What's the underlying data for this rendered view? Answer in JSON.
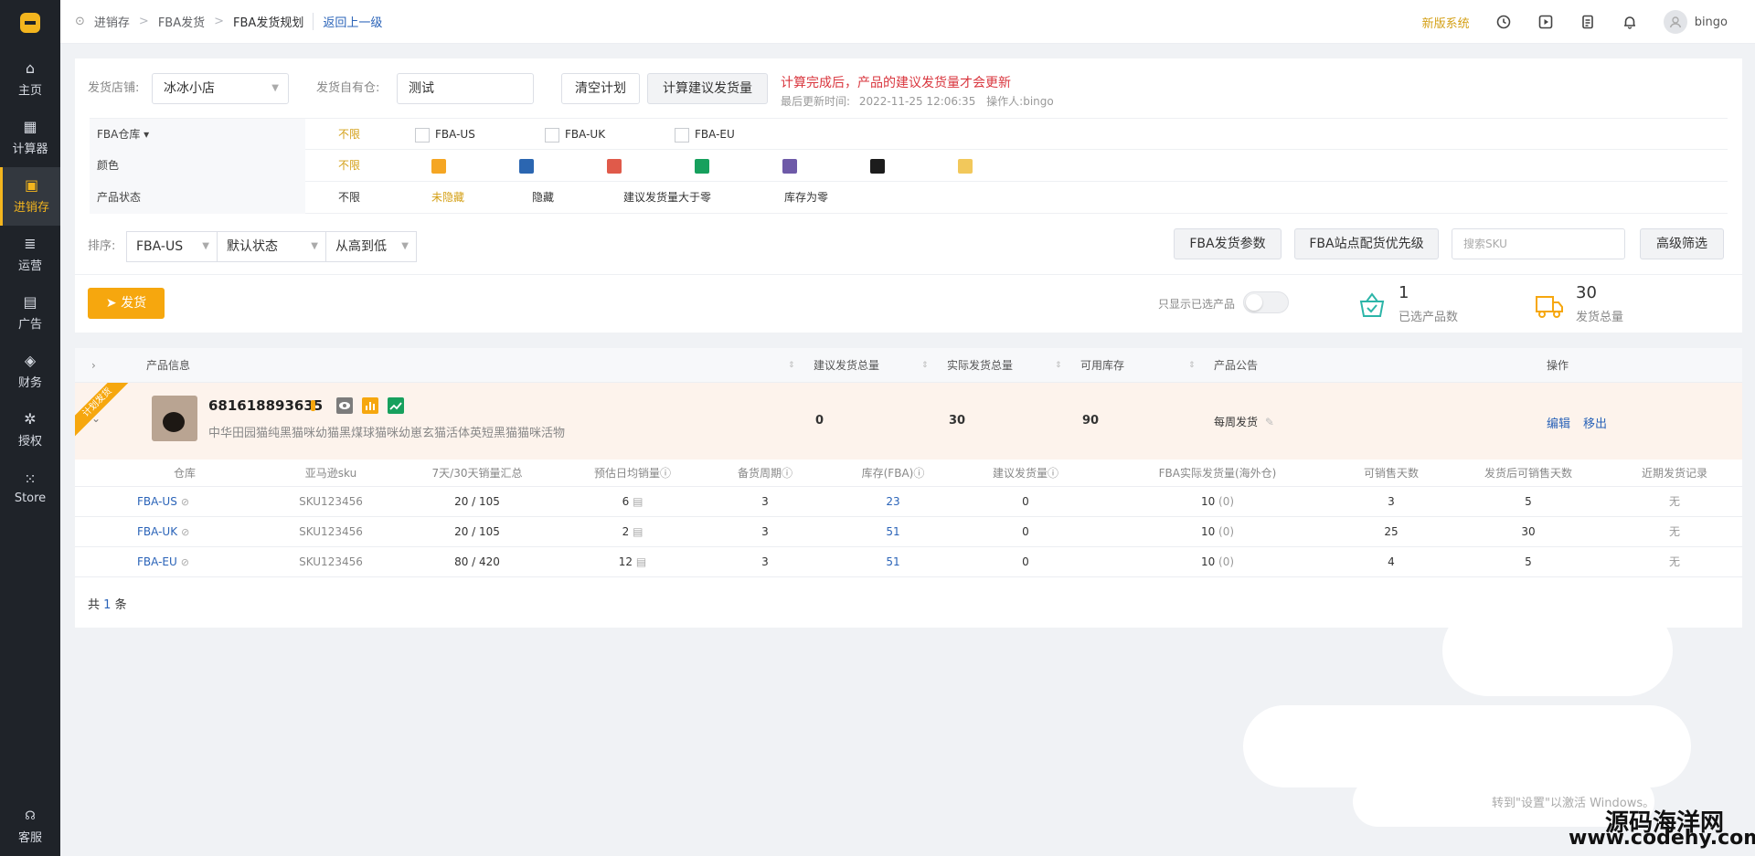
{
  "sidebar": {
    "items": [
      {
        "label": "主页",
        "icon": "home-icon"
      },
      {
        "label": "计算器",
        "icon": "calculator-icon"
      },
      {
        "label": "进销存",
        "icon": "inventory-icon"
      },
      {
        "label": "运营",
        "icon": "operation-icon"
      },
      {
        "label": "广告",
        "icon": "ad-icon"
      },
      {
        "label": "财务",
        "icon": "finance-icon"
      },
      {
        "label": "授权",
        "icon": "gear-icon"
      },
      {
        "label": "Store",
        "icon": "grid-icon"
      }
    ],
    "active": "进销存",
    "support_label": "客服"
  },
  "topbar": {
    "breadcrumb": [
      "进销存",
      "FBA发货",
      "FBA发货规划"
    ],
    "back_label": "返回上一级",
    "new_system_label": "新版系统",
    "username": "bingo"
  },
  "filters": {
    "store_label": "发货店铺:",
    "store_value": "冰冰小店",
    "warehouse_label": "发货自有仓:",
    "warehouse_value": "测试",
    "clear_btn": "清空计划",
    "calc_btn": "计算建议发货量",
    "warning": "计算完成后，产品的建议发货量才会更新",
    "last_update_label": "最后更新时间:",
    "last_update_time": "2022-11-25 12:06:35",
    "operator_label": "操作人:",
    "operator": "bingo",
    "fba_row": {
      "label": "FBA仓库 ▾",
      "options": [
        "不限",
        "FBA-US",
        "FBA-UK",
        "FBA-EU"
      ]
    },
    "color_row": {
      "label": "颜色",
      "all": "不限",
      "colors": [
        "#f5a623",
        "#2b66b1",
        "#e05a4a",
        "#16a05d",
        "#6e5aa8",
        "#1c1c1c",
        "#f2c85b"
      ]
    },
    "status_row": {
      "label": "产品状态",
      "options": [
        "不限",
        "未隐藏",
        "隐藏",
        "建议发货量大于零",
        "库存为零"
      ]
    }
  },
  "sort": {
    "label": "排序:",
    "warehouse": "FBA-US",
    "state": "默认状态",
    "order": "从高到低"
  },
  "actions": {
    "fba_params_btn": "FBA发货参数",
    "priority_btn": "FBA站点配货优先级",
    "search_placeholder": "搜索SKU",
    "advanced_btn": "高级筛选",
    "ship_btn": "发货",
    "only_selected_label": "只显示已选产品"
  },
  "stats": {
    "selected_count": "1",
    "selected_label": "已选产品数",
    "ship_total": "30",
    "ship_total_label": "发货总量"
  },
  "table": {
    "headers": [
      "产品信息",
      "建议发货总量",
      "实际发货总量",
      "可用库存",
      "产品公告",
      "操作"
    ],
    "product": {
      "ribbon": "计划发货",
      "id": "681618893635",
      "title": "中华田园猫纯黑猫咪幼猫黑煤球猫咪幼崽玄猫活体英短黑猫猫咪活物",
      "suggested_total": "0",
      "actual_total": "30",
      "available_stock": "90",
      "notice": "每周发货",
      "edit": "编辑",
      "remove": "移出"
    },
    "sub_headers": [
      "仓库",
      "亚马逊sku",
      "7天/30天销量汇总",
      "预估日均销量",
      "备货周期",
      "库存(FBA)",
      "建议发货量",
      "FBA实际发货量(海外仓)",
      "可销售天数",
      "发货后可销售天数",
      "近期发货记录"
    ],
    "rows": [
      {
        "warehouse": "FBA-US",
        "sku": "SKU123456",
        "sales": "20 / 105",
        "daily": "6",
        "cycle": "3",
        "stock": "23",
        "suggest": "0",
        "actual": "10",
        "actual_sub": "(0)",
        "days": "3",
        "days_after": "5",
        "recent": "无"
      },
      {
        "warehouse": "FBA-UK",
        "sku": "SKU123456",
        "sales": "20 / 105",
        "daily": "2",
        "cycle": "3",
        "stock": "51",
        "suggest": "0",
        "actual": "10",
        "actual_sub": "(0)",
        "days": "25",
        "days_after": "30",
        "recent": "无"
      },
      {
        "warehouse": "FBA-EU",
        "sku": "SKU123456",
        "sales": "80 / 420",
        "daily": "12",
        "cycle": "3",
        "stock": "51",
        "suggest": "0",
        "actual": "10",
        "actual_sub": "(0)",
        "days": "4",
        "days_after": "5",
        "recent": "无"
      }
    ],
    "total_prefix": "共",
    "total_count": "1",
    "total_suffix": "条"
  },
  "overlay": {
    "windows_activate": "转到\"设置\"以激活 Windows。",
    "watermark_cn": "源码海洋网",
    "watermark_url": "www.codehy.com"
  }
}
